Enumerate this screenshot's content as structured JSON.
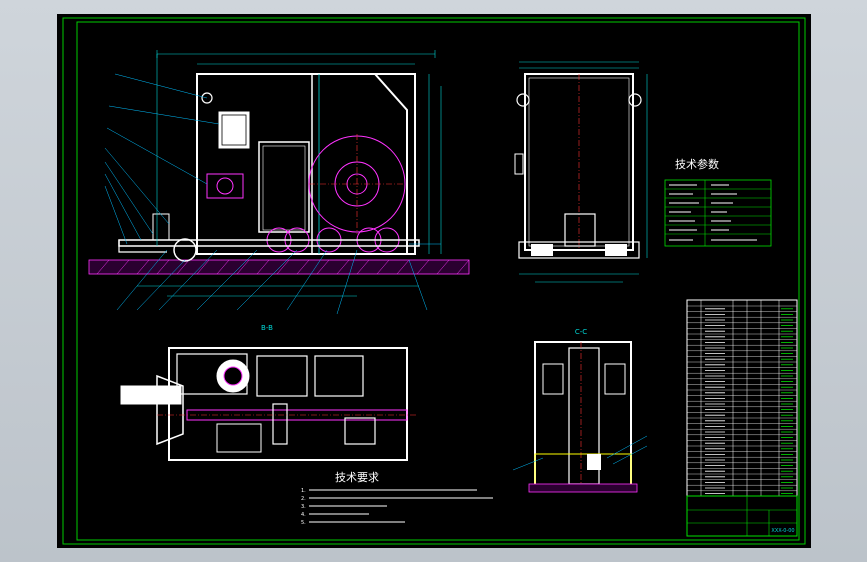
{
  "drawing": {
    "section_bb": "B-B",
    "section_cc": "C-C",
    "tech_params_title": "技术参数",
    "tech_req_title": "技术要求",
    "tech_req_items": [
      "1.",
      "2.",
      "3.",
      "4.",
      "5."
    ],
    "title_block_right": "XXX-0-00"
  },
  "colors": {
    "sheet_bg": "#000000",
    "frame": "#00cc00",
    "outline": "#ffffff",
    "dimension": "#00d7d7",
    "hatch": "#ff33ff",
    "leader": "#00bfff",
    "center": "#ff3333",
    "table": "#00e000"
  }
}
